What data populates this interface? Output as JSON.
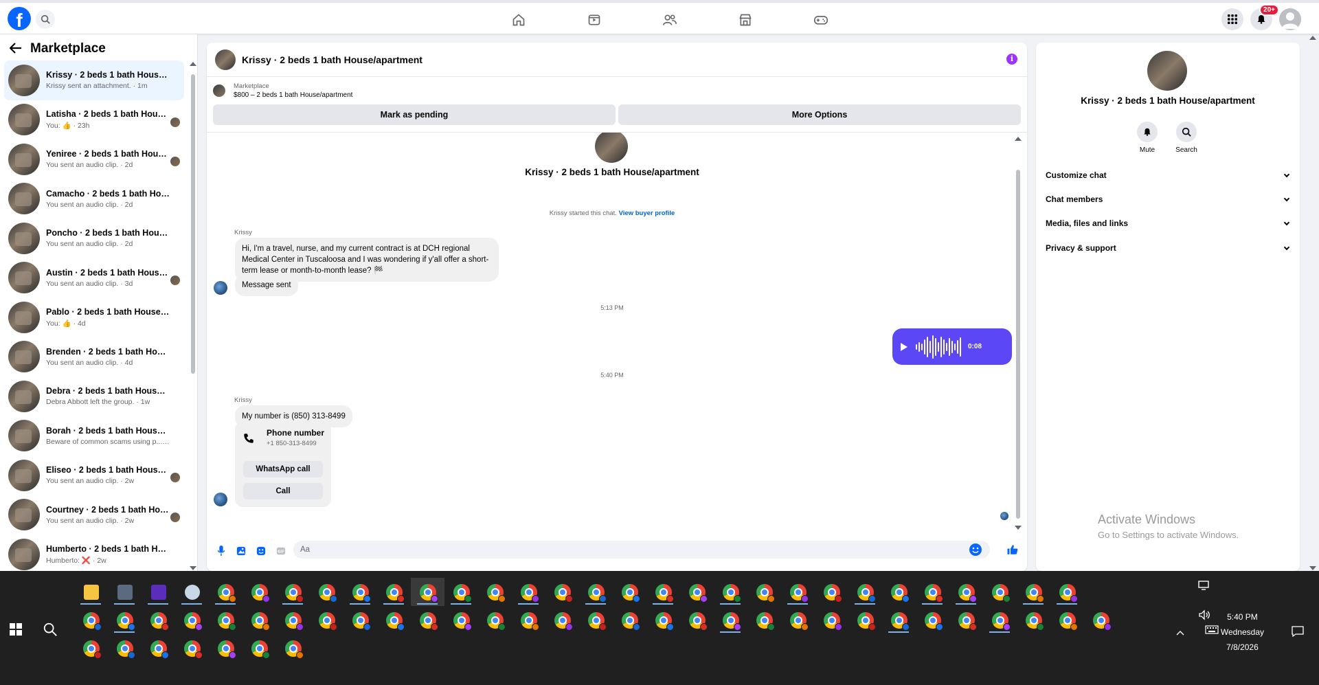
{
  "nav": {
    "logo_letter": "f",
    "notif_count": "20+"
  },
  "sidebar": {
    "title": "Marketplace",
    "conversations": [
      {
        "name": "Krissy · 2 beds 1 bath House/ap...",
        "sub": "Krissy sent an attachment. · 1m",
        "active": true,
        "mini": false
      },
      {
        "name": "Latisha · 2 beds 1 bath House...",
        "sub": "You: 👍 · 23h",
        "active": false,
        "mini": true
      },
      {
        "name": "Yeniree · 2 beds 1 bath House...",
        "sub": "You sent an audio clip. · 2d",
        "active": false,
        "mini": true
      },
      {
        "name": "Camacho · 2 beds 1 bath House...",
        "sub": "You sent an audio clip. · 2d",
        "active": false,
        "mini": false
      },
      {
        "name": "Poncho · 2 beds 1 bath House/a...",
        "sub": "You sent an audio clip. · 2d",
        "active": false,
        "mini": false
      },
      {
        "name": "Austin · 2 beds 1 bath House/...",
        "sub": "You sent an audio clip. · 3d",
        "active": false,
        "mini": true
      },
      {
        "name": "Pablo · 2 beds 1 bath House/ap...",
        "sub": "You: 👍 · 4d",
        "active": false,
        "mini": false
      },
      {
        "name": "Brenden · 2 beds 1 bath House/...",
        "sub": "You sent an audio clip. · 4d",
        "active": false,
        "mini": false
      },
      {
        "name": "Debra · 2 beds 1 bath House/ap...",
        "sub": "Debra Abbott left the group. · 1w",
        "active": false,
        "mini": false
      },
      {
        "name": "Borah · 2 beds 1 bath House/ap...",
        "sub": "Beware of common scams using p... · 1w",
        "active": false,
        "mini": false
      },
      {
        "name": "Eliseo · 2 beds 1 bath House/...",
        "sub": "You sent an audio clip. · 2w",
        "active": false,
        "mini": true
      },
      {
        "name": "Courtney · 2 beds 1 bath Hou...",
        "sub": "You sent an audio clip. · 2w",
        "active": false,
        "mini": true
      },
      {
        "name": "Humberto · 2 beds 1 bath Hous...",
        "sub": "Humberto: ❌ · 2w",
        "active": false,
        "mini": false
      }
    ]
  },
  "chat": {
    "header_name": "Krissy · 2 beds 1 bath House/apartment",
    "listing_label": "Marketplace",
    "listing_price": "$800 – 2 beds 1 bath House/apartment",
    "btn_pending": "Mark as pending",
    "btn_more": "More Options",
    "intro_name": "Krissy · 2 beds 1 bath House/apartment",
    "started_text": "Krissy started this chat. ",
    "started_link": "View buyer profile",
    "sender1": "Krissy",
    "msg1": "Hi, I'm a travel, nurse, and my current contract is at DCH regional Medical Center in Tuscaloosa and I was wondering if y'all offer a short-term lease or month-to-month lease? 🏁",
    "msg2": "Message sent",
    "time1": "5:13 PM",
    "audio_duration": "0:08",
    "time2": "5:40 PM",
    "sender2": "Krissy",
    "msg3": "My number is (850) 313-8499",
    "phone_title": "Phone number",
    "phone_number": "+1 850-313-8499",
    "btn_whatsapp": "WhatsApp call",
    "btn_call": "Call",
    "composer_placeholder": "Aa"
  },
  "rpanel": {
    "name": "Krissy · 2 beds 1 bath House/apartment",
    "mute_label": "Mute",
    "search_label": "Search",
    "rows": [
      "Customize chat",
      "Chat members",
      "Media, files and links",
      "Privacy & support"
    ]
  },
  "watermark": {
    "line1": "Activate Windows",
    "line2": "Go to Settings to activate Windows."
  },
  "taskbar": {
    "time": "5:40 PM",
    "day": "Wednesday",
    "date": "7/8/2026"
  },
  "colors": {
    "brand": "#0866ff",
    "audio_bubble": "#5b47f5",
    "info_icon": "#a033ff",
    "badge": "#e41e3f"
  }
}
